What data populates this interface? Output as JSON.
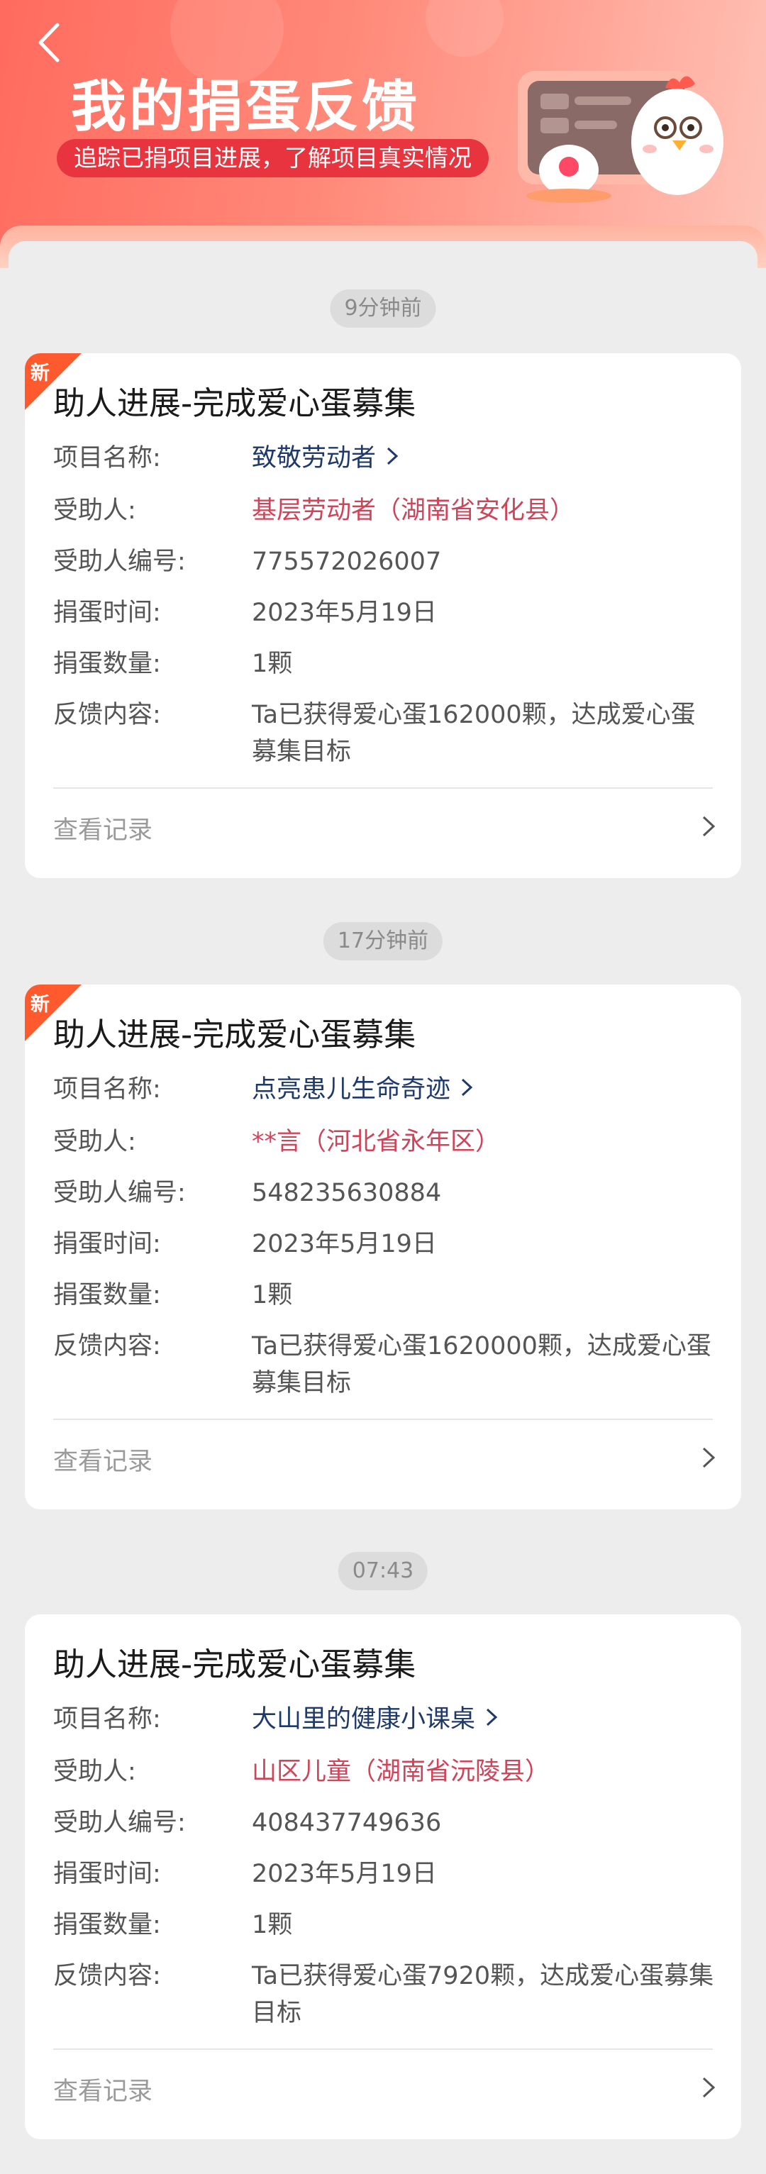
{
  "header": {
    "title": "我的捐蛋反馈",
    "subtitle": "追踪已捐项目进展，了解项目真实情况",
    "back_icon": "chevron-left-icon",
    "brand_color": "#ff6b5e",
    "subtitle_bg": "#e8343f"
  },
  "feed": [
    {
      "time": "9分钟前",
      "is_new": true,
      "new_label": "新",
      "title": "助人进展-完成爱心蛋募集",
      "project_label": "项目名称:",
      "project_name": "致敬劳动者",
      "recipient_label": "受助人:",
      "recipient": "基层劳动者（湖南省安化县）",
      "recipient_id_label": "受助人编号:",
      "recipient_id": "775572026007",
      "donate_time_label": "捐蛋时间:",
      "donate_time": "2023年5月19日",
      "egg_count_label": "捐蛋数量:",
      "egg_count": "1颗",
      "feedback_label": "反馈内容:",
      "feedback": "Ta已获得爱心蛋162000颗，达成爱心蛋募集目标",
      "view_record": "查看记录"
    },
    {
      "time": "17分钟前",
      "is_new": true,
      "new_label": "新",
      "title": "助人进展-完成爱心蛋募集",
      "project_label": "项目名称:",
      "project_name": "点亮患儿生命奇迹",
      "recipient_label": "受助人:",
      "recipient": "**言（河北省永年区）",
      "recipient_id_label": "受助人编号:",
      "recipient_id": "548235630884",
      "donate_time_label": "捐蛋时间:",
      "donate_time": "2023年5月19日",
      "egg_count_label": "捐蛋数量:",
      "egg_count": "1颗",
      "feedback_label": "反馈内容:",
      "feedback": "Ta已获得爱心蛋1620000颗，达成爱心蛋募集目标",
      "view_record": "查看记录"
    },
    {
      "time": "07:43",
      "is_new": false,
      "new_label": "",
      "title": "助人进展-完成爱心蛋募集",
      "project_label": "项目名称:",
      "project_name": "大山里的健康小课桌",
      "recipient_label": "受助人:",
      "recipient": "山区儿童（湖南省沅陵县）",
      "recipient_id_label": "受助人编号:",
      "recipient_id": "408437749636",
      "donate_time_label": "捐蛋时间:",
      "donate_time": "2023年5月19日",
      "egg_count_label": "捐蛋数量:",
      "egg_count": "1颗",
      "feedback_label": "反馈内容:",
      "feedback": "Ta已获得爱心蛋7920颗，达成爱心蛋募集目标",
      "view_record": "查看记录"
    }
  ]
}
